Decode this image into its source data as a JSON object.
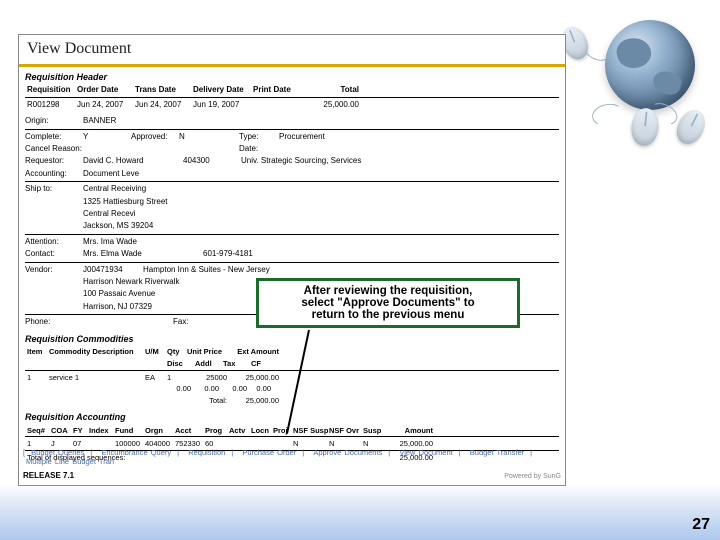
{
  "decor": {
    "globe_name": "globe-icon",
    "mouse_name": "mouse-icon"
  },
  "panel": {
    "title": "View Document",
    "req_header_label": "Requisition Header",
    "headers": {
      "req": "Requisition",
      "order": "Order Date",
      "trans": "Trans Date",
      "delivery": "Delivery Date",
      "print": "Print Date",
      "total": "Total"
    },
    "main": {
      "req": "R001298",
      "order": "Jun 24, 2007",
      "trans": "Jun 24, 2007",
      "delivery": "Jun 19, 2007",
      "print": "",
      "total": "25,000.00"
    },
    "origin": {
      "lbl": "Origin:",
      "val": "BANNER"
    },
    "complete": {
      "lbl": "Complete:",
      "val": "Y",
      "approved_lbl": "Approved:",
      "approved": "N",
      "type_lbl": "Type:",
      "type": "Procurement"
    },
    "cancel": {
      "lbl": "Cancel Reason:",
      "date_lbl": "Date:"
    },
    "requestor": {
      "lbl": "Requestor:",
      "name": "David C. Howard",
      "code": "404300",
      "dept": "Univ. Strategic Sourcing, Services"
    },
    "accounting": {
      "lbl": "Accounting:",
      "val": "Document Leve"
    },
    "shipto": {
      "lbl": "Ship to:",
      "l1": "Central Receiving",
      "l2": "1325 Hattiesburg Street",
      "l3": "Central Recevi",
      "l4": "Jackson, MS 39204"
    },
    "attn": {
      "lbl": "Attention:",
      "val": "Mrs. Ima Wade"
    },
    "contact": {
      "lbl": "Contact:",
      "val": "Mrs. Elma Wade",
      "phone": "601-979-4181"
    },
    "vendor": {
      "lbl": "Vendor:",
      "id": "J00471934",
      "name": "Hampton Inn & Suites - New Jersey",
      "l2": "Harrison Newark Riverwalk",
      "l3": "100 Passaic Avenue",
      "l4": "Harrison, NJ 07329"
    },
    "phone_lbl": "Phone:",
    "fax_lbl": "Fax:",
    "commod_label": "Requisition Commodities",
    "commod": {
      "h": {
        "item": "Item",
        "desc": "Commodity Description",
        "uom": "U/M",
        "qty": "Qty",
        "unitp": "Unit Price",
        "ext": "Ext Amount",
        "disc": "Disc",
        "addl": "Addl",
        "tax": "Tax",
        "cf": "CF"
      },
      "row": {
        "item": "1",
        "desc": "service 1",
        "uom": "EA",
        "qty": "1",
        "unitp": "25000",
        "ext": "25,000.00",
        "disc": "0.00",
        "addl": "0.00",
        "tax": "0.00",
        "cf": "0.00"
      },
      "total_lbl": "Total:",
      "total": "25,000.00"
    },
    "acct_label": "Requisition Accounting",
    "acct": {
      "h": {
        "seq": "Seq#",
        "coa": "COA",
        "fy": "FY",
        "index": "Index",
        "fund": "Fund",
        "orgn": "Orgn",
        "acct": "Acct",
        "prog": "Prog",
        "actv": "Actv",
        "locn": "Locn",
        "proj": "Proj",
        "nsf": "NSF Susp",
        "nsfo": "NSF Ovr",
        "susp": "Susp",
        "amt": "Amount"
      },
      "row": {
        "seq": "1",
        "coa": "J",
        "fy": "07",
        "index": "",
        "fund": "100000",
        "orgn": "404000",
        "acct": "752330",
        "prog": "60",
        "actv": "",
        "locn": "",
        "proj": "",
        "nsf": "N",
        "nsfo": "N",
        "susp": "N",
        "amt": "25,000.00"
      },
      "foot_lbl": "Total of displayed sequences:",
      "foot": "25,000.00"
    },
    "links": {
      "bq": "Budget Queries",
      "eq": "Encumbrance Query",
      "rq": "Requisition",
      "po": "Purchase Order",
      "ad": "Approve Documents",
      "vd": "View Document",
      "bt": "Budget Transfer",
      "mb": "Multiple Line Budget Tran"
    },
    "release": "RELEASE 7.1",
    "powered": "Powered by SunG"
  },
  "callout": {
    "l1": "After reviewing the requisition,",
    "l2": "select \"Approve Documents\" to",
    "l3": "return to the previous menu"
  },
  "page_number": "27"
}
